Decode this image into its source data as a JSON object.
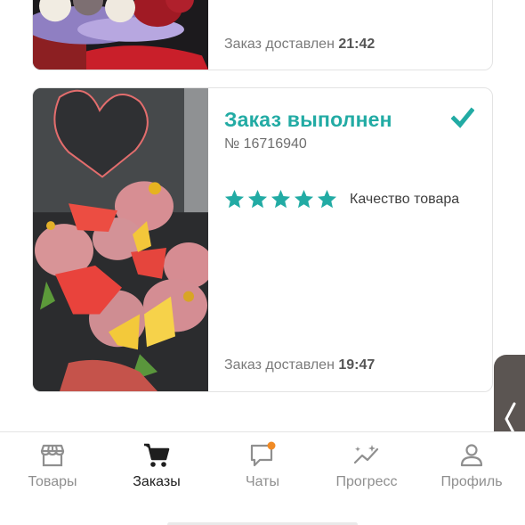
{
  "orders": [
    {
      "delivered_label": "Заказ доставлен",
      "delivered_time": "21:42"
    },
    {
      "status": "Заказ выполнен",
      "number": "№ 16716940",
      "rating": 5,
      "rating_label": "Качество товара",
      "delivered_label": "Заказ доставлен",
      "delivered_time": "19:47"
    }
  ],
  "tabbar": {
    "items": [
      {
        "label": "Товары",
        "icon": "store-icon"
      },
      {
        "label": "Заказы",
        "icon": "cart-icon",
        "active": true
      },
      {
        "label": "Чаты",
        "icon": "chat-icon"
      },
      {
        "label": "Прогресс",
        "icon": "progress-icon"
      },
      {
        "label": "Профиль",
        "icon": "profile-icon"
      }
    ]
  },
  "colors": {
    "accent": "#22aba4",
    "text_muted": "#8f8f8f",
    "notification_dot": "#f08a24"
  }
}
